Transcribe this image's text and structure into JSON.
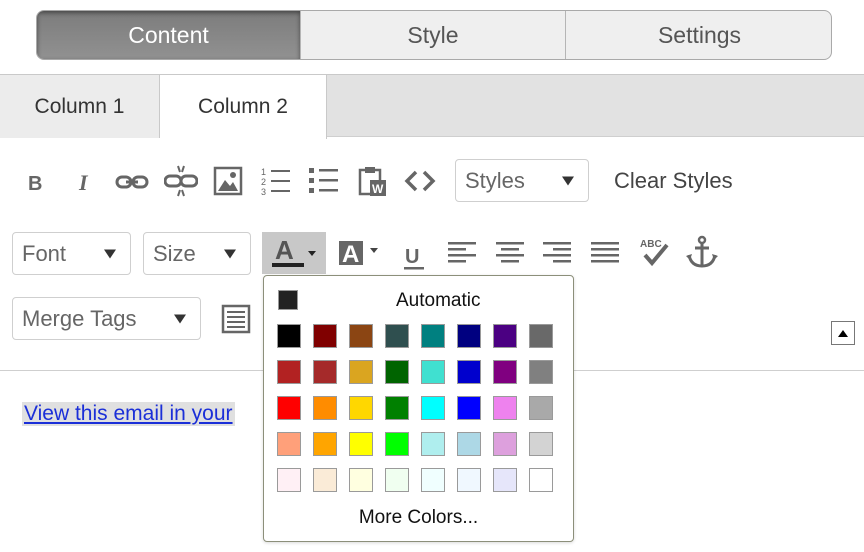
{
  "tabs": [
    {
      "label": "Content",
      "active": true
    },
    {
      "label": "Style",
      "active": false
    },
    {
      "label": "Settings",
      "active": false
    }
  ],
  "column_tabs": [
    {
      "label": "Column 1",
      "active": false
    },
    {
      "label": "Column 2",
      "active": true
    }
  ],
  "toolbar": {
    "styles_dropdown": "Styles",
    "clear_styles": "Clear Styles",
    "font_dropdown": "Font",
    "size_dropdown": "Size",
    "merge_tags_dropdown": "Merge Tags",
    "row1_icons": [
      "bold-icon",
      "italic-icon",
      "link-icon",
      "unlink-icon",
      "image-icon",
      "numbered-list-icon",
      "bullet-list-icon",
      "paste-from-word-icon",
      "source-code-icon"
    ],
    "row2_icons": [
      "text-color-icon",
      "background-color-icon",
      "underline-icon",
      "align-left-icon",
      "align-center-icon",
      "align-right-icon",
      "justify-icon",
      "spellcheck-icon",
      "anchor-icon"
    ],
    "row3_icons": [
      "table-icon",
      "scroll-up-icon"
    ]
  },
  "editor": {
    "link_text": "View this email in your"
  },
  "color_popup": {
    "automatic_label": "Automatic",
    "automatic_color": "#222222",
    "more_colors_label": "More Colors...",
    "swatches": [
      [
        "#000000",
        "#800000",
        "#8B4513",
        "#2F4F4F",
        "#008080",
        "#000080",
        "#4B0082",
        "#696969"
      ],
      [
        "#B22222",
        "#A52A2A",
        "#DAA520",
        "#006400",
        "#40E0D0",
        "#0000CD",
        "#800080",
        "#808080"
      ],
      [
        "#FF0000",
        "#FF8C00",
        "#FFD700",
        "#008000",
        "#00FFFF",
        "#0000FF",
        "#EE82EE",
        "#A9A9A9"
      ],
      [
        "#FFA07A",
        "#FFA500",
        "#FFFF00",
        "#00FF00",
        "#AFEEEE",
        "#ADD8E6",
        "#DDA0DD",
        "#D3D3D3"
      ],
      [
        "#FFF0F5",
        "#FAEBD7",
        "#FFFFE0",
        "#F0FFF0",
        "#F0FFFF",
        "#F0F8FF",
        "#E6E6FA",
        "#FFFFFF"
      ]
    ]
  }
}
